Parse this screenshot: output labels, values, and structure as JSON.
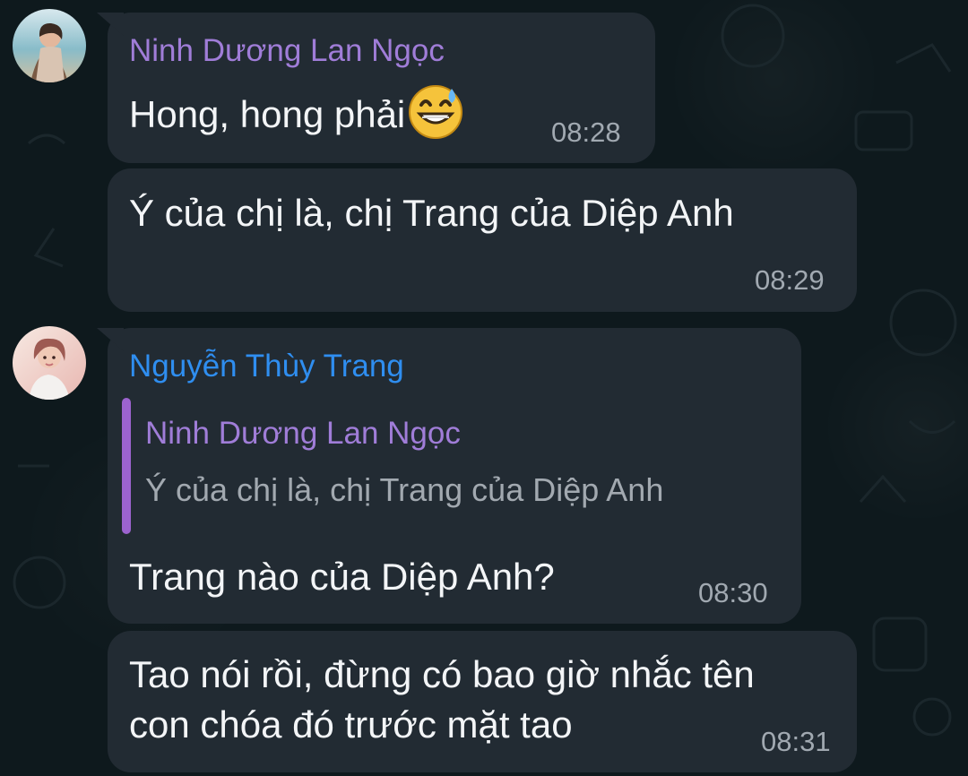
{
  "messages": [
    {
      "sender": "Ninh Dương Lan Ngọc",
      "text": "Hong, hong phải",
      "emoji": "grinning-sweat-emoji",
      "time": "08:28"
    },
    {
      "text": "Ý của chị là, chị Trang của Diệp Anh",
      "time": "08:29"
    },
    {
      "sender": "Nguyễn Thùy Trang",
      "reply": {
        "sender": "Ninh Dương Lan Ngọc",
        "text": "Ý của chị là, chị Trang của Diệp Anh"
      },
      "text": "Trang nào của Diệp Anh?",
      "time": "08:30"
    },
    {
      "lines": [
        "Tao nói rồi, đừng có bao giờ nhắc tên",
        "con chóa đó trước mặt tao"
      ],
      "time": "08:31"
    }
  ],
  "colors": {
    "background": "#0e191d",
    "bubble": "#222b33",
    "sender_purple": "#a07dd8",
    "sender_blue": "#2f8ef0",
    "reply_bar": "#9c63cf",
    "time": "#a1a9b1"
  },
  "icons": {
    "avatar_1": "avatar-ninh-duong-lan-ngoc",
    "avatar_2": "avatar-nguyen-thuy-trang"
  }
}
